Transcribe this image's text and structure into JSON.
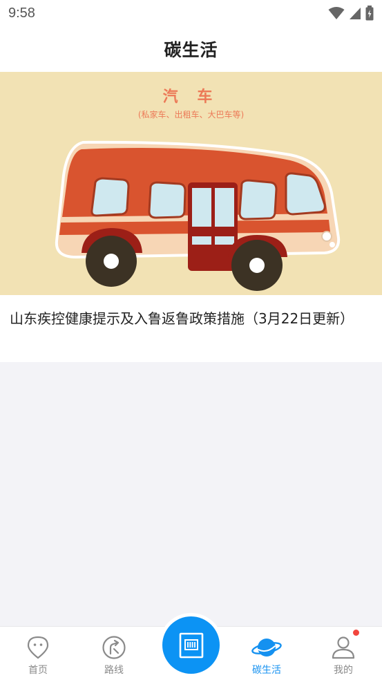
{
  "status_bar": {
    "time": "9:58"
  },
  "header": {
    "title": "碳生活"
  },
  "article": {
    "banner_title": "汽 车",
    "banner_subtitle": "(私家车、出租车、大巴车等)",
    "title": "山东疾控健康提示及入鲁返鲁政策措施（3月22日更新）"
  },
  "bottom_nav": {
    "items": [
      {
        "label": "首页",
        "icon": "map-pin-icon",
        "active": false
      },
      {
        "label": "路线",
        "icon": "route-arrow-icon",
        "active": false
      },
      {
        "label": "碳生活",
        "icon": "planet-icon",
        "active": true
      },
      {
        "label": "我的",
        "icon": "user-icon",
        "active": false,
        "has_badge": true
      }
    ],
    "center_button_icon": "scan-card-icon"
  },
  "colors": {
    "accent": "#1591f0",
    "center_button": "#0c93f4",
    "badge": "#f2453d",
    "banner_background": "#f2e2b4",
    "bus_body": "#d9542f"
  }
}
